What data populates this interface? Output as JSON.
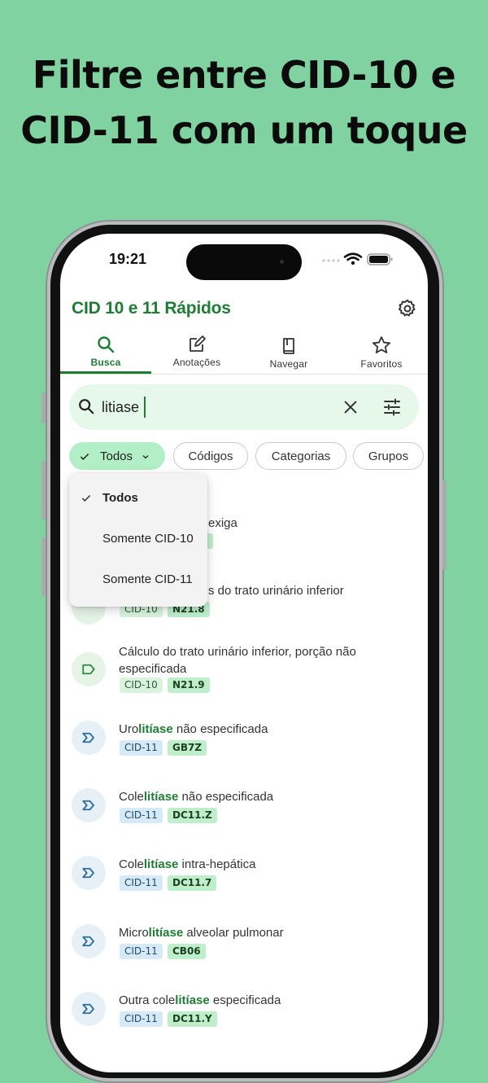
{
  "headline": {
    "line1": "Filtre entre CID-10 e",
    "line2": "CID-11 com um toque"
  },
  "status": {
    "time": "19:21"
  },
  "app": {
    "title": "CID 10 e 11 Rápidos"
  },
  "tabs": [
    {
      "label": "Busca",
      "icon": "search-icon",
      "active": true
    },
    {
      "label": "Anotações",
      "icon": "edit-icon"
    },
    {
      "label": "Navegar",
      "icon": "book-icon"
    },
    {
      "label": "Favoritos",
      "icon": "star-icon"
    }
  ],
  "search": {
    "value": "litiase"
  },
  "chips": [
    {
      "label": "Todos",
      "selected": true
    },
    {
      "label": "Códigos"
    },
    {
      "label": "Categorias"
    },
    {
      "label": "Grupos"
    }
  ],
  "dropdown": {
    "items": [
      {
        "label": "Todos",
        "checked": true
      },
      {
        "label": "Somente CID-10"
      },
      {
        "label": "Somente CID-11"
      }
    ]
  },
  "results": [
    {
      "title_pre": "",
      "title_hl": "",
      "title_post": "exiga",
      "version": "CID-10",
      "code": ""
    },
    {
      "title_pre": "",
      "title_hl": "",
      "title_post": "s do trato urinário inferior",
      "version": "CID-10",
      "code": "N21.8"
    },
    {
      "title_pre": "Cálculo do trato urinário inferior, porção não especificada",
      "title_hl": "",
      "title_post": "",
      "version": "CID-10",
      "code": "N21.9"
    },
    {
      "title_pre": "Uro",
      "title_hl": "litíase",
      "title_post": " não especificada",
      "version": "CID-11",
      "code": "GB7Z"
    },
    {
      "title_pre": "Cole",
      "title_hl": "litíase",
      "title_post": " não especificada",
      "version": "CID-11",
      "code": "DC11.Z"
    },
    {
      "title_pre": "Cole",
      "title_hl": "litíase",
      "title_post": " intra-hepática",
      "version": "CID-11",
      "code": "DC11.7"
    },
    {
      "title_pre": "Micro",
      "title_hl": "litíase",
      "title_post": " alveolar pulmonar",
      "version": "CID-11",
      "code": "CB06"
    },
    {
      "title_pre": "Outra cole",
      "title_hl": "litíase",
      "title_post": " especificada",
      "version": "CID-11",
      "code": "DC11.Y"
    }
  ],
  "colors": {
    "background": "#80d3a1",
    "brand": "#1e7d33",
    "chip_selected": "#b3efc6",
    "search_bg": "#e6f8e9"
  }
}
